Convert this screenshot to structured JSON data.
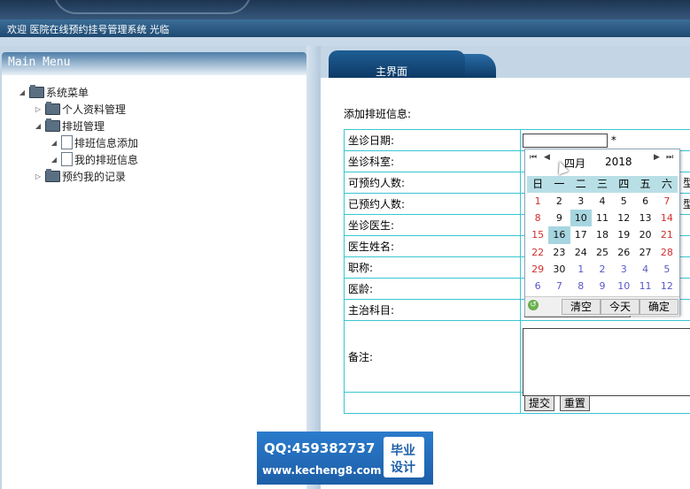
{
  "header": {
    "welcome_text": "欢迎 医院在线预约挂号管理系统 光临"
  },
  "menu": {
    "title": "Main Menu",
    "tree": {
      "root": "系统菜单",
      "personal": "个人资料管理",
      "schedule": "排班管理",
      "schedule_add": "排班信息添加",
      "my_schedule": "我的排班信息",
      "my_appointments": "预约我的记录"
    }
  },
  "tab": {
    "main_label": "主界面"
  },
  "form": {
    "title": "添加排班信息:",
    "required_mark": "*",
    "rows": [
      "坐诊日期:",
      "坐诊科室:",
      "可预约人数:",
      "已预约人数:",
      "坐诊医生:",
      "医生姓名:",
      "职称:",
      "医龄:",
      "主治科目:",
      "备注:"
    ],
    "partial_text_1": "型",
    "partial_text_2": "型",
    "major_value_partial": "面",
    "submit_label": "提交",
    "reset_label": "重置"
  },
  "calendar": {
    "nav_prev_year": "⏮",
    "nav_prev_month": "◀",
    "month": "四月",
    "year": "2018",
    "nav_next_month": "▶",
    "nav_next_year": "⏭",
    "weekdays": [
      "日",
      "一",
      "二",
      "三",
      "四",
      "五",
      "六"
    ],
    "days": [
      {
        "t": "1",
        "c": "d-sun"
      },
      {
        "t": "2",
        "c": "d-cur"
      },
      {
        "t": "3",
        "c": "d-cur"
      },
      {
        "t": "4",
        "c": "d-cur"
      },
      {
        "t": "5",
        "c": "d-cur"
      },
      {
        "t": "6",
        "c": "d-cur"
      },
      {
        "t": "7",
        "c": "d-sat"
      },
      {
        "t": "8",
        "c": "d-sun"
      },
      {
        "t": "9",
        "c": "d-cur"
      },
      {
        "t": "10",
        "c": "d-cur d-sel"
      },
      {
        "t": "11",
        "c": "d-cur"
      },
      {
        "t": "12",
        "c": "d-cur"
      },
      {
        "t": "13",
        "c": "d-cur"
      },
      {
        "t": "14",
        "c": "d-sat"
      },
      {
        "t": "15",
        "c": "d-sun"
      },
      {
        "t": "16",
        "c": "d-cur d-sel"
      },
      {
        "t": "17",
        "c": "d-cur"
      },
      {
        "t": "18",
        "c": "d-cur"
      },
      {
        "t": "19",
        "c": "d-cur"
      },
      {
        "t": "20",
        "c": "d-cur"
      },
      {
        "t": "21",
        "c": "d-sat"
      },
      {
        "t": "22",
        "c": "d-sun"
      },
      {
        "t": "23",
        "c": "d-cur"
      },
      {
        "t": "24",
        "c": "d-cur"
      },
      {
        "t": "25",
        "c": "d-cur"
      },
      {
        "t": "26",
        "c": "d-cur"
      },
      {
        "t": "27",
        "c": "d-cur"
      },
      {
        "t": "28",
        "c": "d-sat"
      },
      {
        "t": "29",
        "c": "d-sun"
      },
      {
        "t": "30",
        "c": "d-cur"
      },
      {
        "t": "1",
        "c": "d-other"
      },
      {
        "t": "2",
        "c": "d-other"
      },
      {
        "t": "3",
        "c": "d-other"
      },
      {
        "t": "4",
        "c": "d-other"
      },
      {
        "t": "5",
        "c": "d-other"
      },
      {
        "t": "6",
        "c": "d-other"
      },
      {
        "t": "7",
        "c": "d-other"
      },
      {
        "t": "8",
        "c": "d-other"
      },
      {
        "t": "9",
        "c": "d-other"
      },
      {
        "t": "10",
        "c": "d-other"
      },
      {
        "t": "11",
        "c": "d-other"
      },
      {
        "t": "12",
        "c": "d-other"
      }
    ],
    "clear_label": "清空",
    "today_label": "今天",
    "ok_label": "确定"
  },
  "watermark": {
    "qq": "QQ:459382737",
    "url": "www.kecheng8.com",
    "badge_line1": "毕业",
    "badge_line2": "设计"
  }
}
